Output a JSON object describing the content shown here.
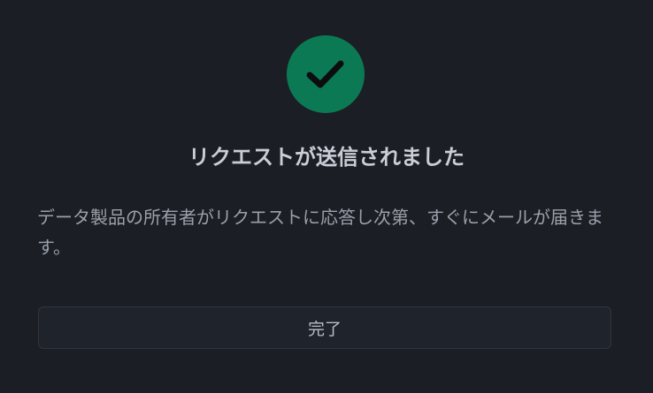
{
  "colors": {
    "background": "#1b1e24",
    "success": "#0b7a54",
    "check": "#0b0d10",
    "title_text": "#c9ced8",
    "body_text": "#9aa0ab",
    "button_bg": "#1f242c",
    "button_border": "#2f353e",
    "button_text": "#b7bcc6"
  },
  "icon": {
    "success": "check-circle-icon"
  },
  "dialog": {
    "title": "リクエストが送信されました",
    "message": "データ製品の所有者がリクエストに応答し次第、すぐにメールが届きます。",
    "done_label": "完了"
  }
}
